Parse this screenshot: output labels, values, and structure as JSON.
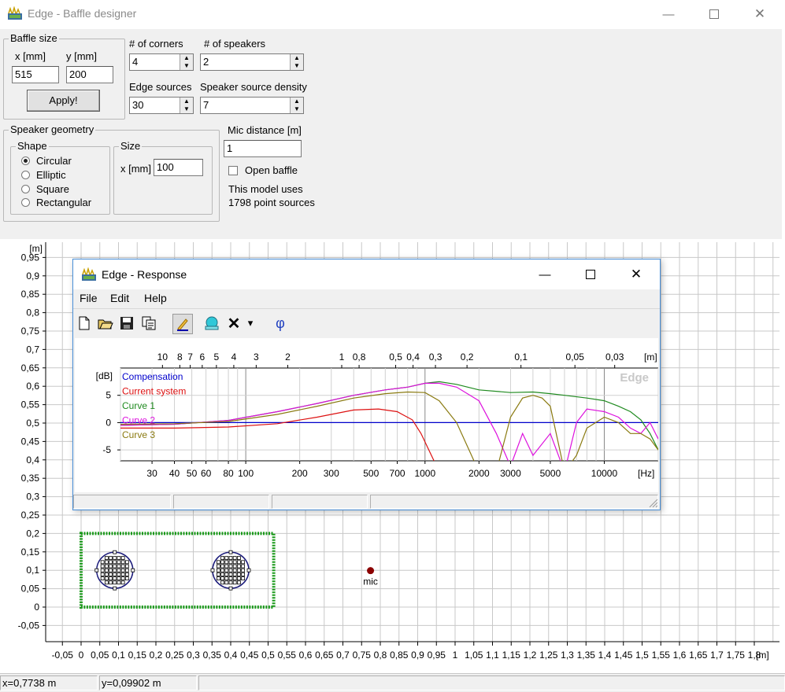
{
  "window": {
    "title": "Edge - Baffle designer"
  },
  "baffle_size": {
    "legend": "Baffle size",
    "x_label": "x [mm]",
    "y_label": "y [mm]",
    "x_value": "515",
    "y_value": "200",
    "apply_label": "Apply!"
  },
  "corners": {
    "label": "# of corners",
    "value": "4"
  },
  "speakers": {
    "label": "# of speakers",
    "value": "2"
  },
  "edge_sources": {
    "label": "Edge sources",
    "value": "30"
  },
  "speaker_density": {
    "label": "Speaker source density",
    "value": "7"
  },
  "speaker_geometry": {
    "legend": "Speaker geometry",
    "shape_legend": "Shape",
    "shapes": [
      "Circular",
      "Elliptic",
      "Square",
      "Rectangular"
    ],
    "selected_shape": "Circular",
    "size_legend": "Size",
    "size_x_label": "x [mm]",
    "size_x_value": "100"
  },
  "mic": {
    "distance_label": "Mic distance [m]",
    "distance_value": "1",
    "open_baffle_label": "Open baffle",
    "open_baffle_checked": false,
    "info_line1": "This model uses",
    "info_line2": "1798 point sources",
    "marker_label": "mic"
  },
  "baffle_plot": {
    "y_unit": "[m]",
    "x_unit": "[m]",
    "y_ticks": [
      "0,95",
      "0,9",
      "0,85",
      "0,8",
      "0,75",
      "0,7",
      "0,65",
      "0,6",
      "0,55",
      "0,5",
      "0,45",
      "0,4",
      "0,35",
      "0,3",
      "0,25",
      "0,2",
      "0,15",
      "0,1",
      "0,05",
      "0",
      "-0,05"
    ],
    "x_ticks": [
      "-0,05",
      "0",
      "0,05",
      "0,1",
      "0,15",
      "0,2",
      "0,25",
      "0,3",
      "0,35",
      "0,4",
      "0,45",
      "0,5",
      "0,55",
      "0,6",
      "0,65",
      "0,7",
      "0,75",
      "0,8",
      "0,85",
      "0,9",
      "0,95",
      "1",
      "1,05",
      "1,1",
      "1,15",
      "1,2",
      "1,25",
      "1,3",
      "1,35",
      "1,4",
      "1,45",
      "1,5",
      "1,55",
      "1,6",
      "1,65",
      "1,7",
      "1,75",
      "1,8"
    ],
    "baffle_color": "#1a9a1a",
    "speaker_color": "#1a1a7a",
    "mic_color": "#8b0000"
  },
  "status": {
    "x": "x=0,7738 m",
    "y": "y=0,09902 m"
  },
  "response": {
    "title": "Edge - Response",
    "menu": [
      "File",
      "Edit",
      "Help"
    ],
    "toolbar_icons": [
      "new-icon",
      "open-icon",
      "save-icon",
      "copy-icon",
      "pencil-icon",
      "bell-icon",
      "delete-icon",
      "dropdown-arrow-icon",
      "phase-icon"
    ],
    "phase_symbol": "φ",
    "delete_symbol": "✕",
    "dropdown_symbol": "▾"
  },
  "chart_data": {
    "type": "line",
    "watermark": "Edge",
    "ylabel": "[dB]",
    "xlabel": "[Hz]",
    "top_axis_label": "[m]",
    "y_ticks": [
      "5",
      "0",
      "-5"
    ],
    "x_ticks": [
      "30",
      "40",
      "50",
      "60",
      "80",
      "100",
      "200",
      "300",
      "500",
      "700",
      "1000",
      "2000",
      "3000",
      "5000",
      "10000"
    ],
    "top_ticks": [
      "10",
      "8",
      "7",
      "6",
      "5",
      "4",
      "3",
      "2",
      "1",
      "0,8",
      "0,5",
      "0,4",
      "0,3",
      "0,2",
      "0,1",
      "0,05",
      "0,03"
    ],
    "xlim": [
      20,
      20000
    ],
    "ylim": [
      -7,
      10
    ],
    "series": [
      {
        "name": "Compensation",
        "color": "#0000cc",
        "x": [
          20,
          20000
        ],
        "y": [
          0,
          0
        ]
      },
      {
        "name": "Current system",
        "color": "#dd1111",
        "x": [
          20,
          40,
          80,
          150,
          250,
          400,
          550,
          700,
          850,
          950,
          1050,
          1200
        ],
        "y": [
          -1,
          -1,
          -0.8,
          -0.2,
          1,
          2.3,
          2.5,
          2,
          0.5,
          -2,
          -5,
          -9
        ]
      },
      {
        "name": "Curve 1",
        "color": "#1f8a1f",
        "x": [
          20,
          40,
          80,
          150,
          250,
          400,
          600,
          800,
          1000,
          1200,
          1500,
          2000,
          3000,
          4000,
          5000,
          6000,
          8000,
          10000,
          12000,
          14000,
          16000,
          18000,
          20000
        ],
        "y": [
          -0.5,
          -0.3,
          0.4,
          2,
          3.5,
          5,
          6,
          6.5,
          7.2,
          7.5,
          7,
          6,
          5.5,
          5.6,
          5.3,
          5,
          4.5,
          4,
          3,
          2,
          0.5,
          -2,
          -5
        ]
      },
      {
        "name": "Curve 2",
        "color": "#dd11dd",
        "x": [
          20,
          40,
          80,
          150,
          250,
          400,
          600,
          800,
          1000,
          1200,
          1500,
          2000,
          2500,
          3000,
          3500,
          4000,
          5000,
          6000,
          7000,
          8000,
          10000,
          12000,
          14000,
          16000,
          18000,
          20000
        ],
        "y": [
          -0.5,
          -0.3,
          0.4,
          2,
          3.5,
          5,
          6,
          6.5,
          7.2,
          7.2,
          6.5,
          4,
          -2,
          -8,
          -2,
          -6,
          -2,
          -9,
          0,
          2.5,
          2,
          1,
          -1,
          -2,
          0,
          -3
        ]
      },
      {
        "name": "Curve 3",
        "color": "#8a7a10",
        "x": [
          20,
          40,
          80,
          150,
          250,
          400,
          600,
          800,
          1000,
          1200,
          1500,
          2000,
          2500,
          3000,
          3500,
          4000,
          4500,
          5000,
          6000,
          7000,
          8000,
          10000,
          12000,
          14000,
          16000,
          18000,
          20000
        ],
        "y": [
          -0.3,
          -0.2,
          0.2,
          1.5,
          3,
          4.5,
          5.3,
          5.6,
          5.5,
          4,
          0,
          -9,
          -9,
          1,
          4.5,
          5,
          4.5,
          3,
          -9,
          -6,
          -1,
          1,
          0,
          -2,
          -2,
          -3,
          -5
        ]
      }
    ]
  }
}
